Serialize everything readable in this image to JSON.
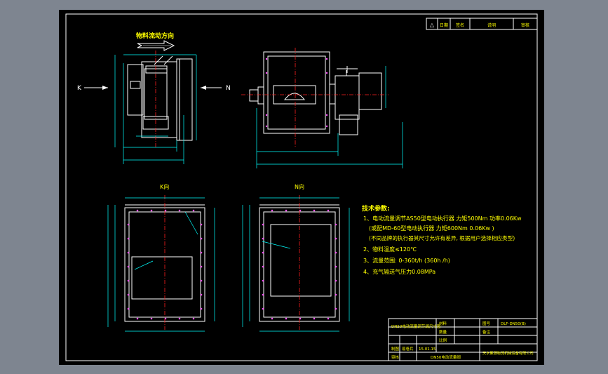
{
  "flow_direction_label": "物料流动方向",
  "side_view_left_label": "K",
  "side_view_right_label": "N",
  "k_view_label": "K向",
  "n_view_label": "N向",
  "tech_params": {
    "title": "技术参数:",
    "lines": [
      "1、电动流量调节AS50型电动执行器  力矩500Nm  功率0.06Kw",
      "(或配MD-60型电动执行器 力矩600Nm  0.06Kw )",
      "(不同品牌的执行器其尺寸允许有差异, 根据用户选择相应类型)",
      "2、物料温度≤120℃",
      "3、流量范围: 0-360t/h (360h /h)",
      "4、充气输送气压力0.08MPa"
    ]
  },
  "revision_table": {
    "col_mark": "△",
    "col_date": "日期",
    "col_signed": "签名",
    "col_desc": "说明",
    "col_review": "审核"
  },
  "title_block": {
    "drawing_title": "DN50电动流量调节阀尺寸图",
    "material_label": "材料",
    "drawing_no_label": "图号",
    "drawing_no": "DLF-DN50(B)",
    "qty_label": "数量",
    "remark_label": "备注",
    "scale_label": "比例",
    "designer_label": "制图",
    "designer": "易卷兵",
    "date": "15.01.15",
    "checker_label": "审核",
    "product_name": "DN50电动流量阀",
    "company": "天水聚源物流机械设备有限公司"
  },
  "colors": {
    "background": "#7e8590",
    "sheet": "#000000",
    "outline": "#ffffff",
    "dimension": "#00ffff",
    "centerline": "#ff2020",
    "text": "#ffff00",
    "hidden": "#ff55ff"
  }
}
